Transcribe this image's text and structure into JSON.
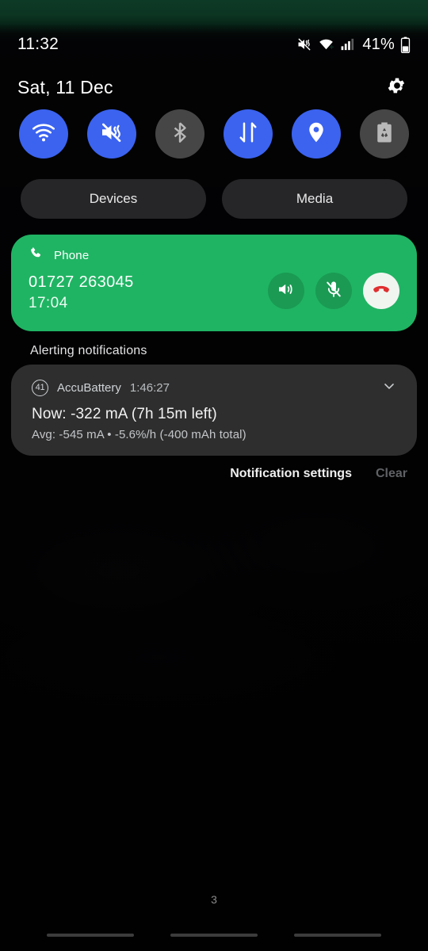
{
  "statusbar": {
    "time": "11:32",
    "battery_percent": "41%",
    "icons": [
      "volume-mute-vibrate-icon",
      "wifi-icon",
      "cellular-signal-icon",
      "battery-icon"
    ]
  },
  "header": {
    "date": "Sat, 11 Dec",
    "settings_icon": "gear-icon"
  },
  "quick_settings": {
    "tiles": [
      {
        "name": "wifi",
        "icon": "wifi-icon",
        "state": "on"
      },
      {
        "name": "sound-vibrate",
        "icon": "volume-mute-vibrate-icon",
        "state": "on"
      },
      {
        "name": "bluetooth",
        "icon": "bluetooth-icon",
        "state": "off"
      },
      {
        "name": "mobile-data",
        "icon": "data-transfer-icon",
        "state": "on"
      },
      {
        "name": "location",
        "icon": "location-pin-icon",
        "state": "on"
      },
      {
        "name": "battery-saver",
        "icon": "battery-saver-icon",
        "state": "off"
      }
    ],
    "pills": [
      {
        "label": "Devices"
      },
      {
        "label": "Media"
      }
    ]
  },
  "call_notification": {
    "app_name": "Phone",
    "app_icon": "phone-handset-icon",
    "number": "01727 263045",
    "duration": "17:04",
    "accent_color": "#1fb463",
    "actions": [
      {
        "name": "speaker",
        "icon": "speaker-icon"
      },
      {
        "name": "mute-microphone",
        "icon": "microphone-muted-icon"
      },
      {
        "name": "end-call",
        "icon": "end-call-icon"
      }
    ]
  },
  "notifications_section": {
    "header": "Alerting notifications",
    "items": [
      {
        "badge": "41",
        "app_name": "AccuBattery",
        "time": "1:46:27",
        "title": "Now: -322 mA (7h 15m left)",
        "subtitle": "Avg: -545 mA • -5.6%/h (-400 mAh total)",
        "expand_icon": "chevron-down-icon"
      }
    ]
  },
  "shade_footer": {
    "settings_label": "Notification settings",
    "clear_label": "Clear"
  },
  "home": {
    "page_indicator": "3"
  }
}
